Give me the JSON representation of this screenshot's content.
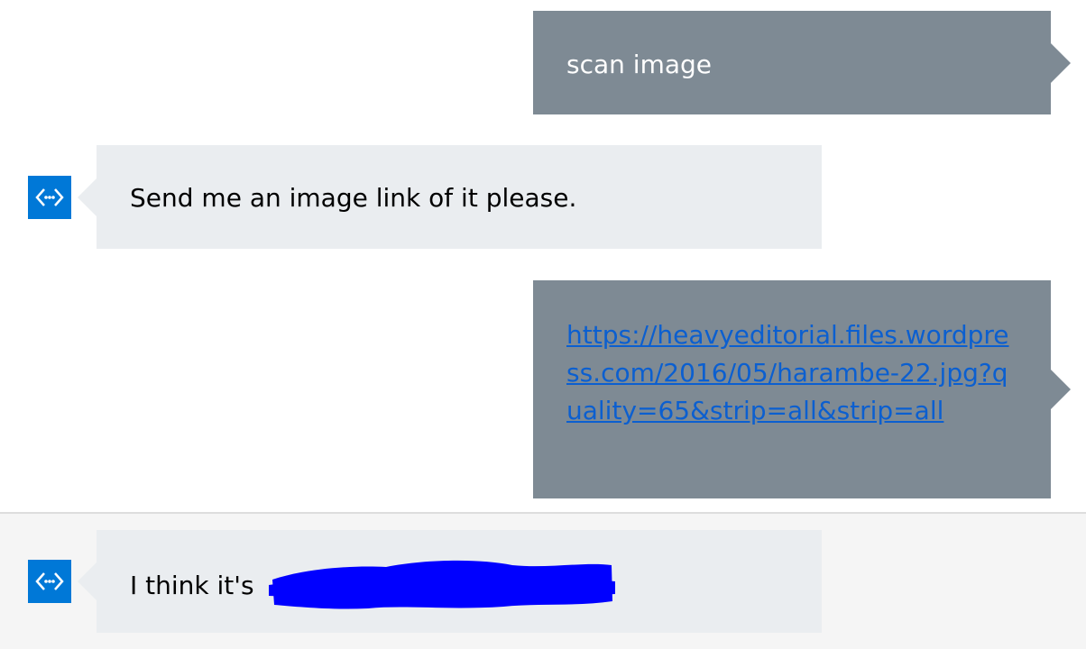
{
  "colors": {
    "user_bubble": "#7e8a94",
    "bot_bubble": "#eaedf0",
    "bot_avatar": "#0078d7",
    "link": "#0b5fd0",
    "redaction": "#0000ff",
    "selected_row": "#f5f5f5"
  },
  "avatar_icon": "bot-code-brackets-icon",
  "messages": [
    {
      "from": "user",
      "text": "scan image"
    },
    {
      "from": "bot",
      "text": "Send me an image link of it please."
    },
    {
      "from": "user",
      "link": "https://heavyeditorial.files.wordpress.com/2016/05/harambe-22.jpg?quality=65&strip=all&strip=all"
    },
    {
      "from": "bot",
      "text": "I think it's",
      "redacted": true
    }
  ]
}
